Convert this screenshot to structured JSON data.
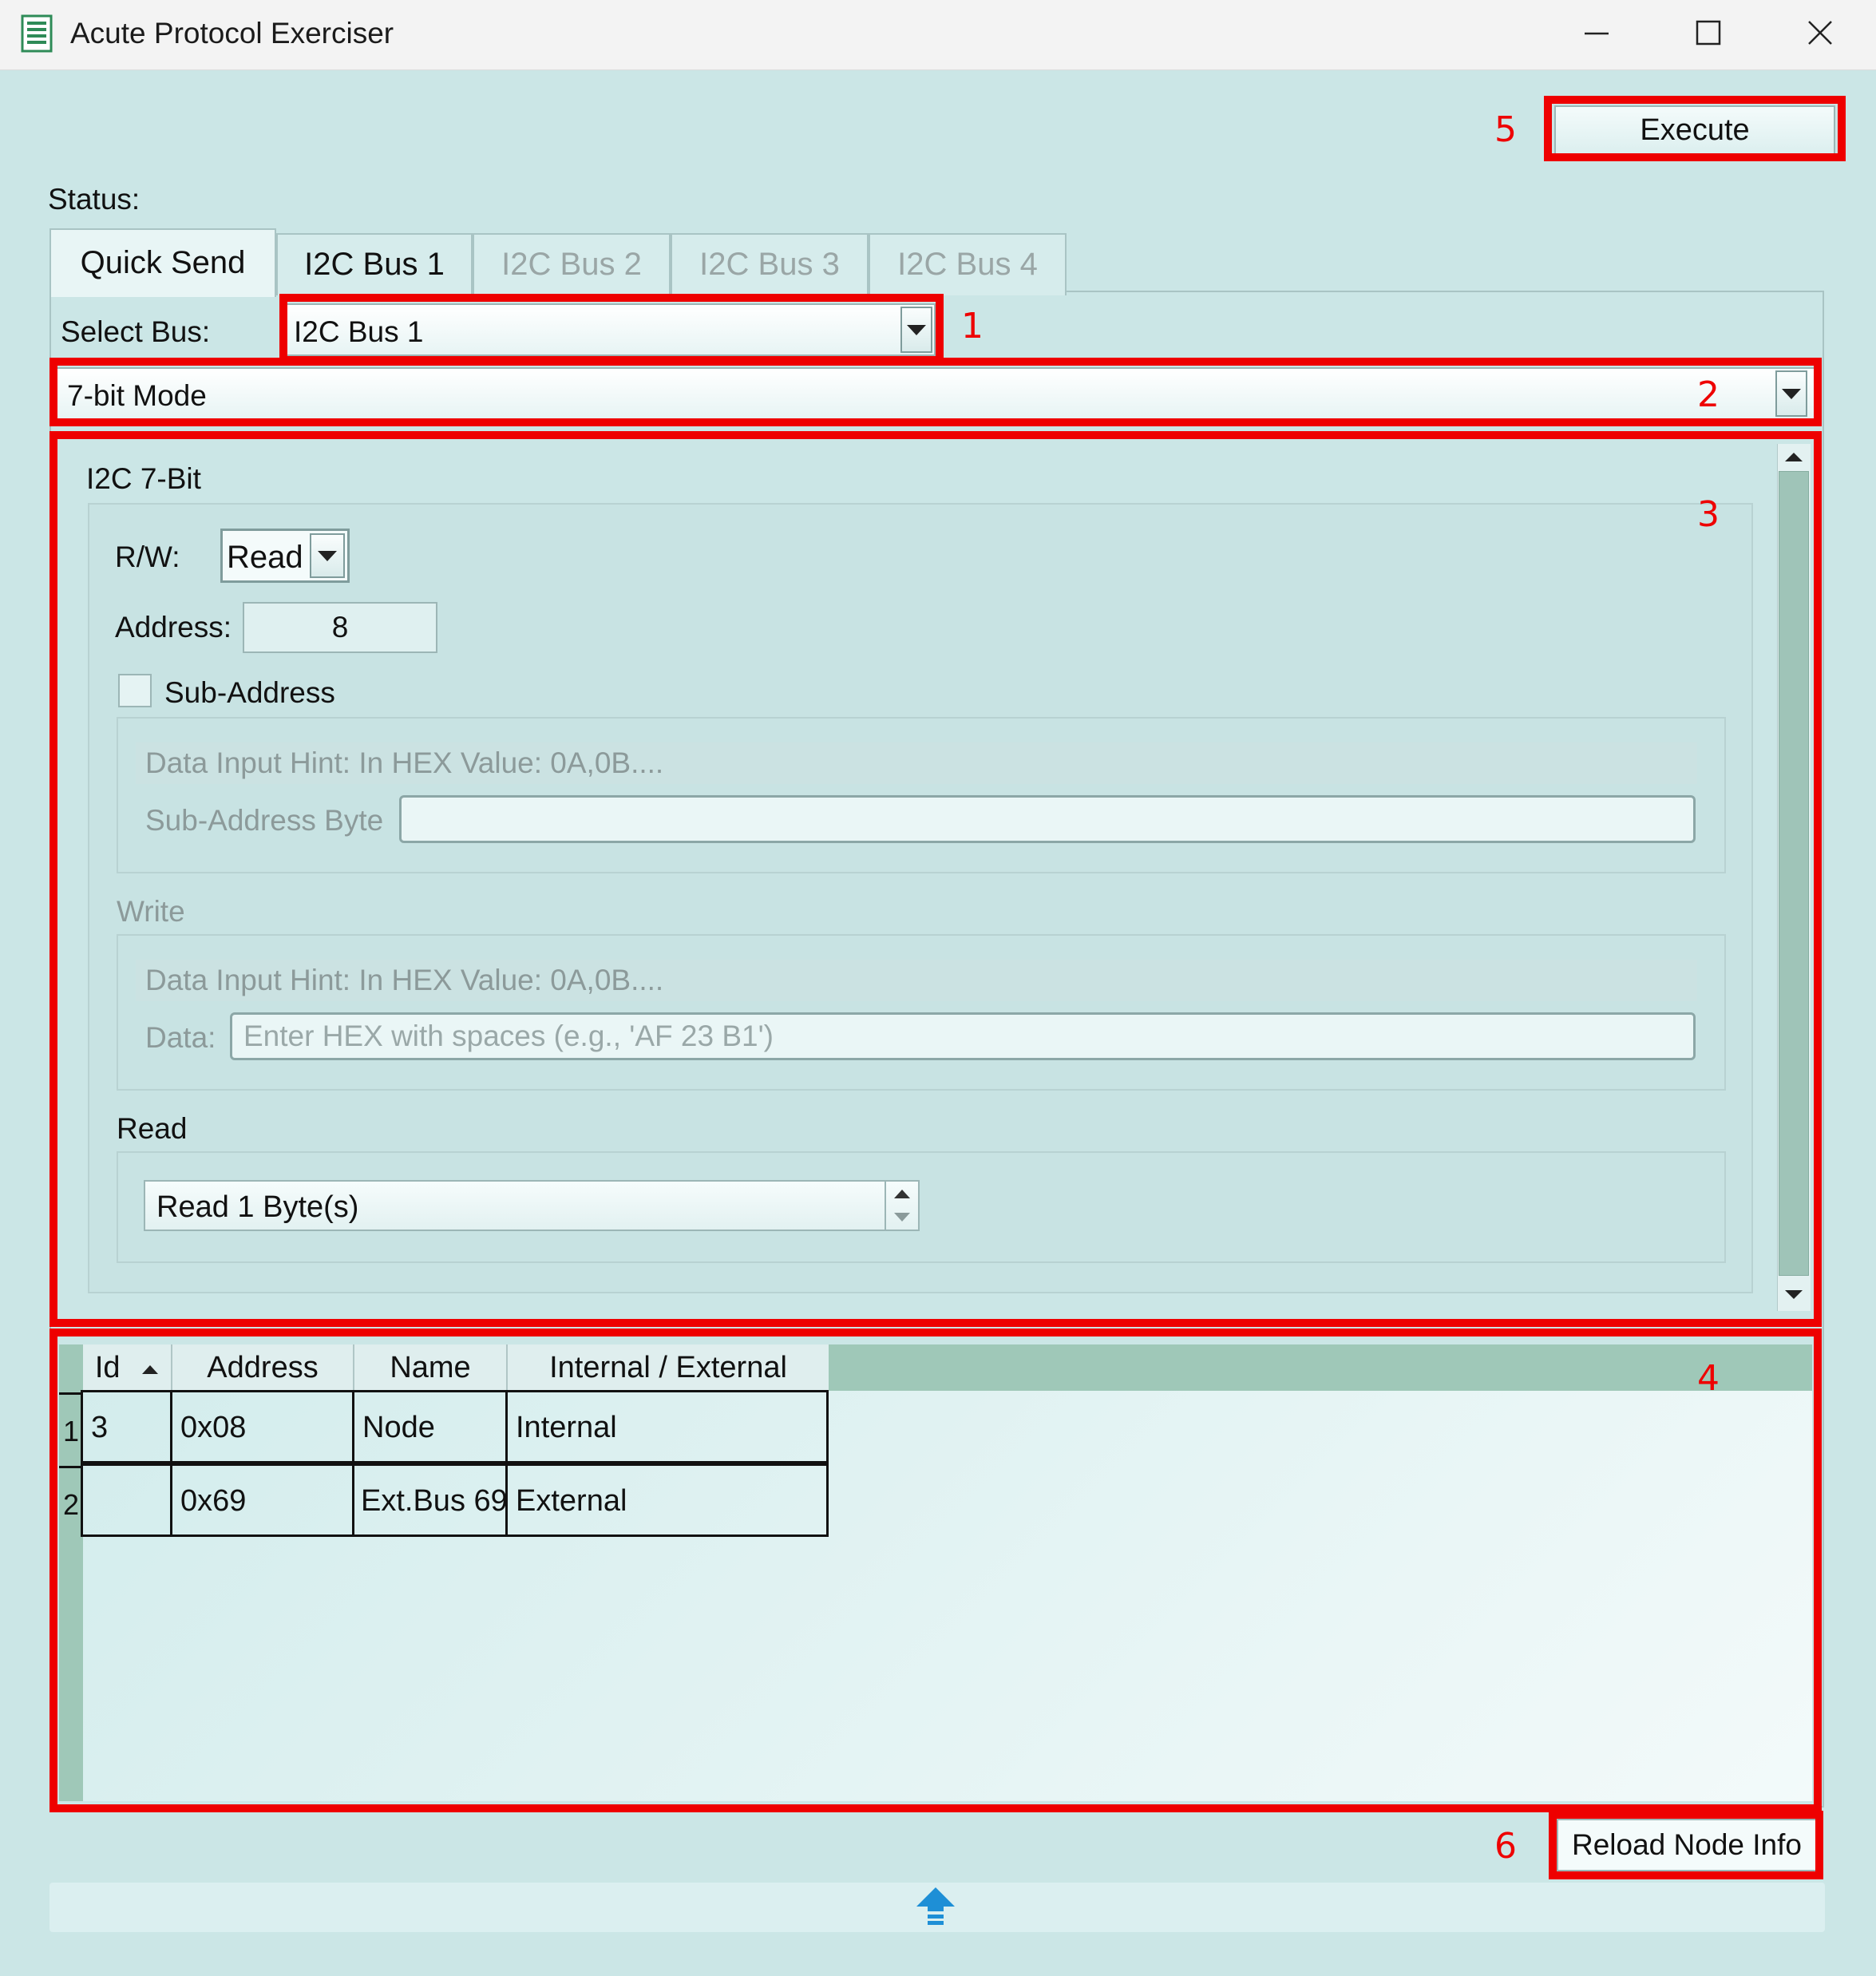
{
  "window": {
    "title": "Acute Protocol Exerciser"
  },
  "toolbar": {
    "execute_label": "Execute"
  },
  "status": {
    "label": "Status:"
  },
  "tabs": [
    {
      "label": "Quick Send",
      "active": true
    },
    {
      "label": "I2C Bus 1",
      "active": false
    },
    {
      "label": "I2C Bus 2",
      "active": false
    },
    {
      "label": "I2C Bus 3",
      "active": false
    },
    {
      "label": "I2C Bus 4",
      "active": false
    }
  ],
  "quick_send": {
    "select_bus_label": "Select Bus:",
    "selected_bus": "I2C Bus 1",
    "mode": "7-bit Mode",
    "group_title": "I2C 7-Bit",
    "rw_label": "R/W:",
    "rw_value": "Read",
    "address_label": "Address:",
    "address_value": "8",
    "sub_address_label": "Sub-Address",
    "sub_address_checked": false,
    "sub_address_hint": "Data Input Hint: In HEX Value: 0A,0B....",
    "sub_address_byte_label": "Sub-Address Byte",
    "sub_address_byte_value": "",
    "write_label": "Write",
    "write_hint": "Data Input Hint: In HEX Value: 0A,0B....",
    "data_label": "Data:",
    "data_placeholder": "Enter HEX with spaces (e.g., 'AF 23 B1')",
    "read_label": "Read",
    "read_value": "Read 1 Byte(s)"
  },
  "node_table": {
    "columns": [
      "Id",
      "Address",
      "Name",
      "Internal / External"
    ],
    "sort_column": "Id",
    "rows": [
      {
        "row": "1",
        "id": "3",
        "address": "0x08",
        "name": "Node",
        "type": "Internal"
      },
      {
        "row": "2",
        "id": "",
        "address": "0x69",
        "name": "Ext.Bus 69",
        "type": "External"
      }
    ]
  },
  "reload_label": "Reload Node Info",
  "annotations": [
    "1",
    "2",
    "3",
    "4",
    "5",
    "6"
  ],
  "colors": {
    "annotation": "#ee0000",
    "background": "#cbe6e6",
    "grid_header": "#9fc8b8"
  },
  "icons": {
    "app": "document-list-icon",
    "bottom": "upload-arrow-icon"
  }
}
